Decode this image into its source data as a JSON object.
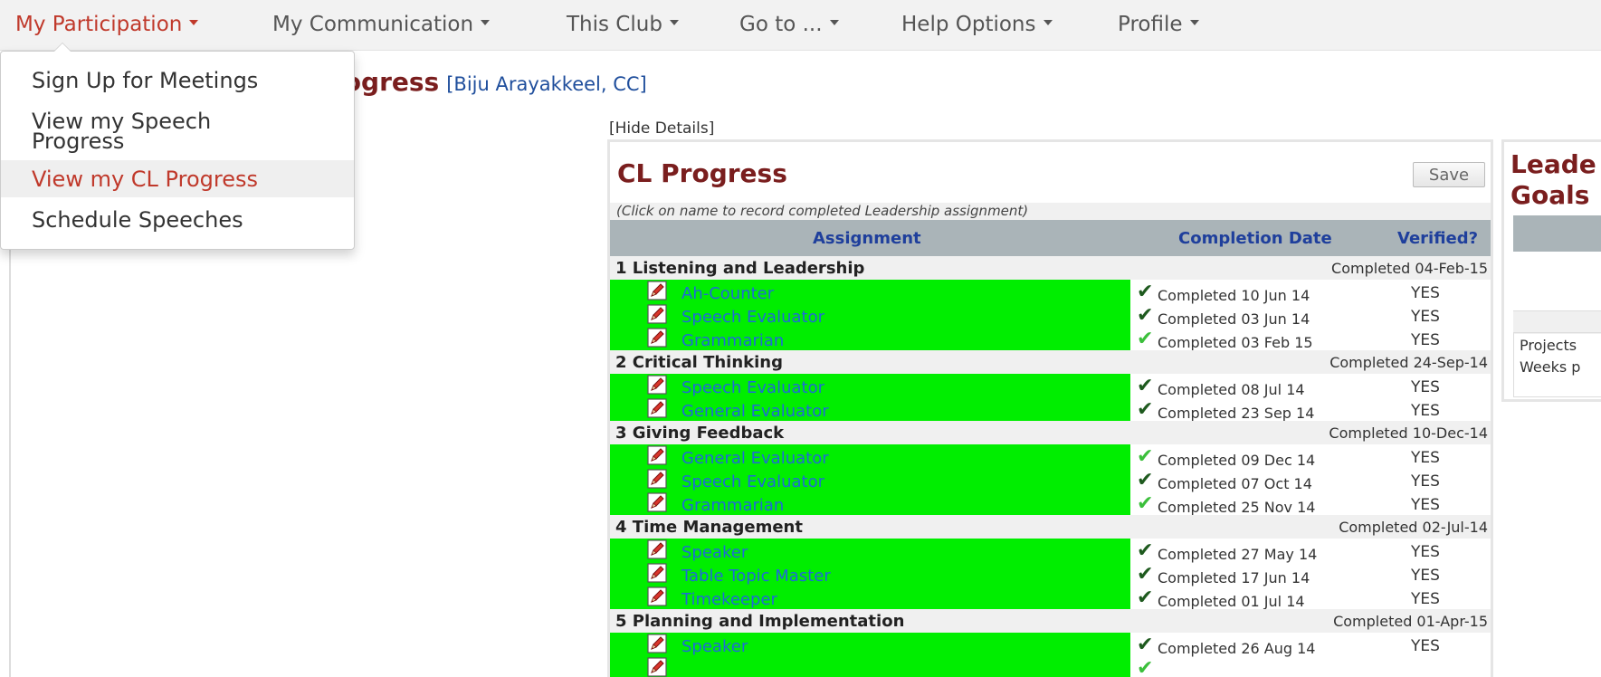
{
  "nav": {
    "items": [
      {
        "label": "My Participation",
        "active": true
      },
      {
        "label": "My Communication",
        "active": false
      },
      {
        "label": "This Club",
        "active": false
      },
      {
        "label": "Go to ...",
        "active": false
      },
      {
        "label": "Help Options",
        "active": false
      },
      {
        "label": "Profile",
        "active": false
      }
    ]
  },
  "dropdown": {
    "items": [
      {
        "label": "Sign Up for Meetings"
      },
      {
        "label": "View my Speech Progress"
      },
      {
        "label": "View my CL Progress",
        "highlighted": true
      },
      {
        "label": "Schedule Speeches"
      }
    ]
  },
  "page": {
    "title_visible": "rogress",
    "member": "[Biju Arayakkeel, CC]",
    "hide_details": "[Hide Details]"
  },
  "cl": {
    "title": "CL Progress",
    "save_label": "Save",
    "instructions": "(Click on name to record completed Leadership assignment)",
    "headers": {
      "assignment": "Assignment",
      "completion_date": "Completion Date",
      "verified": "Verified?"
    },
    "groups": [
      {
        "name": "1 Listening and Leadership",
        "completed": "Completed 04-Feb-15",
        "assignments": [
          {
            "name": "Ah-Counter",
            "date": "Completed 10 Jun 14",
            "verified": "YES",
            "check": "dark"
          },
          {
            "name": "Speech Evaluator",
            "date": "Completed 03 Jun 14",
            "verified": "YES",
            "check": "dark"
          },
          {
            "name": "Grammarian",
            "date": "Completed 03 Feb 15",
            "verified": "YES",
            "check": "light"
          }
        ]
      },
      {
        "name": "2 Critical Thinking",
        "completed": "Completed 24-Sep-14",
        "assignments": [
          {
            "name": "Speech Evaluator",
            "date": "Completed 08 Jul 14",
            "verified": "YES",
            "check": "dark"
          },
          {
            "name": "General Evaluator",
            "date": "Completed 23 Sep 14",
            "verified": "YES",
            "check": "dark"
          }
        ]
      },
      {
        "name": "3 Giving Feedback",
        "completed": "Completed 10-Dec-14",
        "assignments": [
          {
            "name": "General Evaluator",
            "date": "Completed 09 Dec 14",
            "verified": "YES",
            "check": "light"
          },
          {
            "name": "Speech Evaluator",
            "date": "Completed 07 Oct 14",
            "verified": "YES",
            "check": "dark"
          },
          {
            "name": "Grammarian",
            "date": "Completed 25 Nov 14",
            "verified": "YES",
            "check": "light"
          }
        ]
      },
      {
        "name": "4 Time Management",
        "completed": "Completed 02-Jul-14",
        "assignments": [
          {
            "name": "Speaker",
            "date": "Completed 27 May 14",
            "verified": "YES",
            "check": "dark"
          },
          {
            "name": "Table Topic Master",
            "date": "Completed 17 Jun 14",
            "verified": "YES",
            "check": "dark"
          },
          {
            "name": "Timekeeper",
            "date": "Completed 01 Jul 14",
            "verified": "YES",
            "check": "dark"
          }
        ]
      },
      {
        "name": "5 Planning and Implementation",
        "completed": "Completed 01-Apr-15",
        "assignments": [
          {
            "name": "Speaker",
            "date": "Completed 26 Aug 14",
            "verified": "YES",
            "check": "dark"
          },
          {
            "name": "",
            "date": "",
            "verified": "",
            "check": "light"
          }
        ]
      }
    ]
  },
  "leadership": {
    "title": "Leade Goals",
    "title_line1": "Leade",
    "title_line2": "Goals",
    "rows": [
      "Projects",
      "Weeks p"
    ]
  },
  "colors": {
    "accent": "#c0392b",
    "title": "#7a1e1e",
    "link": "#1f6ad6",
    "row_green": "#00ee00",
    "header_bg": "#aab4b8",
    "check_dark": "#1e5a1e",
    "check_light": "#3bbf3b"
  }
}
